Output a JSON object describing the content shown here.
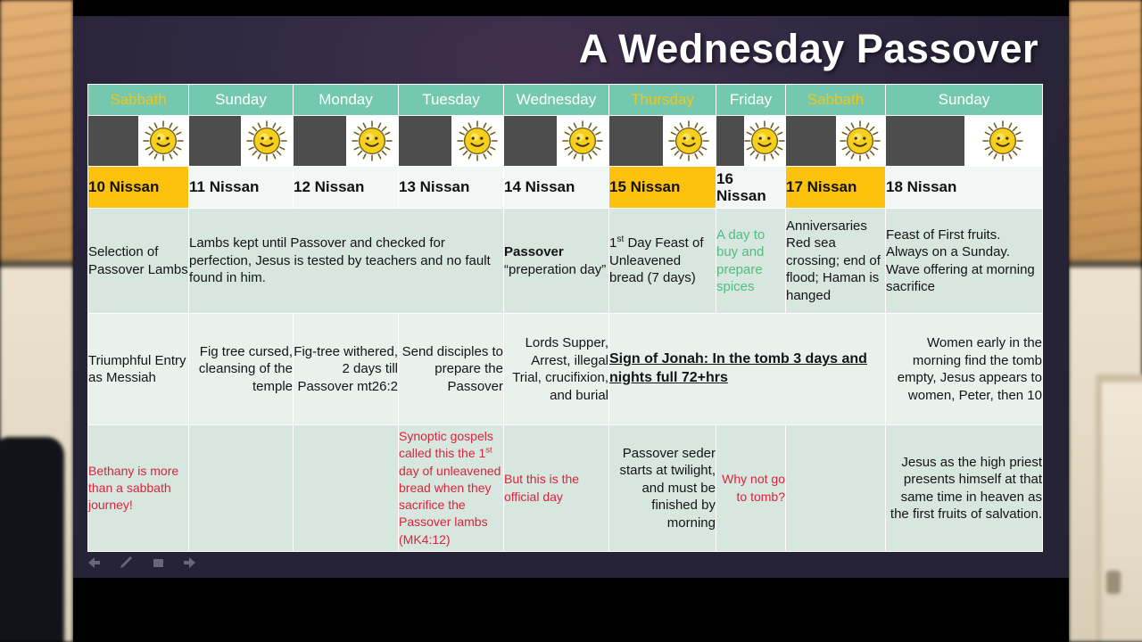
{
  "slide": {
    "title": "A Wednesday Passover"
  },
  "columns": [
    {
      "day": "Sabbath",
      "highlight_day": true,
      "date": "10 Nissan",
      "highlight_date": true
    },
    {
      "day": "Sunday",
      "highlight_day": false,
      "date": "11 Nissan",
      "highlight_date": false
    },
    {
      "day": "Monday",
      "highlight_day": false,
      "date": "12 Nissan",
      "highlight_date": false
    },
    {
      "day": "Tuesday",
      "highlight_day": false,
      "date": "13 Nissan",
      "highlight_date": false
    },
    {
      "day": "Wednesday",
      "highlight_day": false,
      "date": "14 Nissan",
      "highlight_date": false
    },
    {
      "day": "Thursday",
      "highlight_day": true,
      "date": "15 Nissan",
      "highlight_date": true
    },
    {
      "day": "Friday",
      "highlight_day": false,
      "date": "16 Nissan",
      "highlight_date": false
    },
    {
      "day": "Sabbath",
      "highlight_day": true,
      "date": "17 Nissan",
      "highlight_date": true
    },
    {
      "day": "Sunday",
      "highlight_day": false,
      "date": "18 Nissan",
      "highlight_date": false
    }
  ],
  "icons": {
    "sun": "sun-smiley-icon",
    "night": "night-block-icon",
    "toolbar": [
      "back-arrow-icon",
      "pen-icon",
      "rectangle-icon",
      "forward-arrow-icon"
    ]
  },
  "row1": {
    "c1": "Selection of Passover Lambs",
    "c2": "Lambs kept until  Passover and checked for perfection, Jesus is  tested by teachers and no fault found in him.",
    "c3_bold": "Passover",
    "c3_rest": "“preperation day”",
    "c4": "1",
    "c4_sup": "st",
    "c4_rest": " Day Feast of Unleavened bread (7 days)",
    "c5": "A day to buy and prepare spices",
    "c6": "Anniversaries Red sea crossing; end of flood; Haman is hanged",
    "c7": "Feast of First fruits. Always on a Sunday. Wave offering at morning sacrifice"
  },
  "row2": {
    "c1": "Triumphful Entry as Messiah",
    "c2": "Fig tree cursed, cleansing of the temple",
    "c3": "Fig-tree withered,  2 days till Passover mt26:2",
    "c4": "Send disciples to prepare the Passover",
    "c5": "Lords Supper, Arrest, illegal Trial, crucifixion, and burial",
    "c6": "Sign of Jonah: In the tomb 3 days and nights full 72+hrs",
    "c7": "Women early in the morning find the tomb empty, Jesus appears to women, Peter, then 10"
  },
  "row3": {
    "c1": "Bethany  is more than a sabbath journey!",
    "c4_a": "Synoptic gospels called this the 1",
    "c4_sup": "st",
    "c4_b": " day of unleavened bread when they  sacrifice the Passover lambs (MK4:12)",
    "c5": "But this is the official day",
    "c6": "Passover seder starts at twilight, and must be finished by morning",
    "c7": "Why not go to tomb?",
    "c9": "Jesus as the high priest presents himself at that same time in heaven as the first fruits of salvation."
  },
  "colors": {
    "header_green": "#73c8ad",
    "sabbath_gold": "#f5c616",
    "date_highlight": "#fcc20d",
    "night_gray": "#4d4d4d",
    "cell_green_dark": "#d7e6de",
    "cell_green_light": "#e9f1ed",
    "note_red": "#d6263c",
    "note_green": "#4fbd7e",
    "slide_bg": "#332a44"
  }
}
